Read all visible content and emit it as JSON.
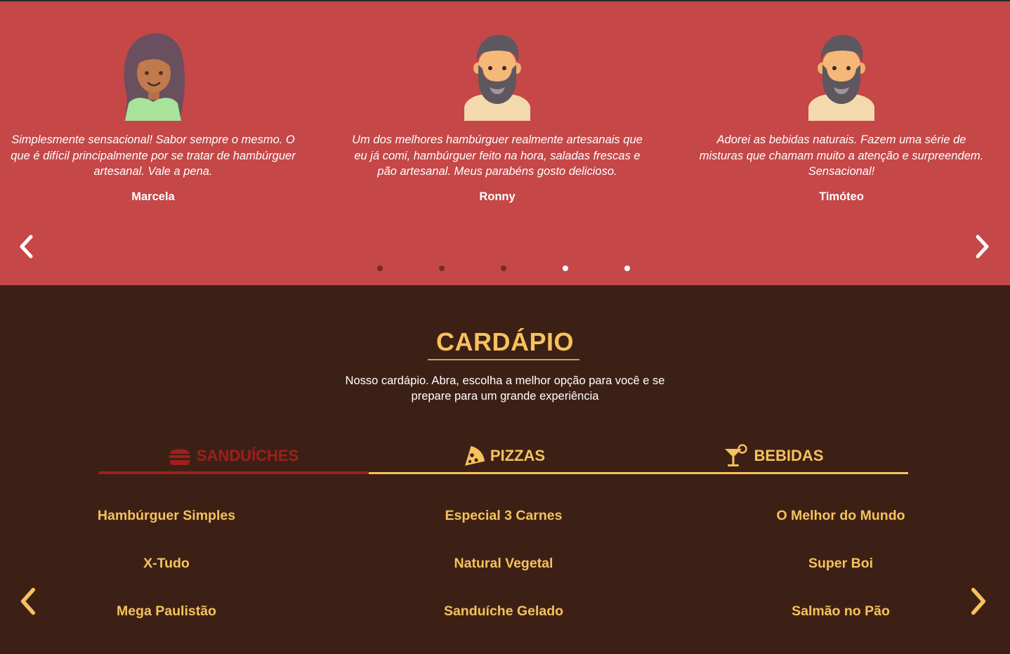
{
  "testimonials": [
    {
      "quote": "Simplesmente sensacional! Sabor sempre o mesmo. O que é difícil principalmente por se tratar de hambúrguer artesanal. Vale a pena.",
      "name": "Marcela",
      "avatar": "woman-avatar-icon"
    },
    {
      "quote": "Um dos melhores hambúrguer realmente artesanais que eu já comi, hambúrguer feito na hora, saladas frescas e pão artesanal. Meus parabéns gosto delicioso.",
      "name": "Ronny",
      "avatar": "bearded-man-avatar-icon"
    },
    {
      "quote": "Adorei as bebidas naturais. Fazem uma série de misturas que chamam muito a atenção e surpreendem. Sensacional!",
      "name": "Timóteo",
      "avatar": "bearded-man-avatar-icon"
    }
  ],
  "carousel": {
    "dot_count": 5,
    "active_dots": [
      3,
      4
    ]
  },
  "menu": {
    "title": "CARDÁPIO",
    "subtitle": "Nosso cardápio. Abra, escolha a melhor opção para você e se prepare para um grande experiência",
    "tabs": [
      {
        "label": "SANDUÍCHES",
        "icon": "burger-icon",
        "active": true
      },
      {
        "label": "PIZZAS",
        "icon": "pizza-slice-icon",
        "active": false
      },
      {
        "label": "BEBIDAS",
        "icon": "cocktail-icon",
        "active": false
      }
    ],
    "columns": [
      [
        "Hambúrguer Simples",
        "X-Tudo",
        "Mega Paulistão"
      ],
      [
        "Especial 3 Carnes",
        "Natural Vegetal",
        "Sanduíche Gelado"
      ],
      [
        "O Melhor do Mundo",
        "Super Boi",
        "Salmão no Pão"
      ]
    ]
  },
  "colors": {
    "testimonial_bg": "#c54747",
    "menu_bg": "#3d2015",
    "accent_gold": "#f5c25c",
    "active_red": "#a01e1e",
    "dot_inactive": "#7a2a22",
    "dot_active": "#ffffff"
  }
}
